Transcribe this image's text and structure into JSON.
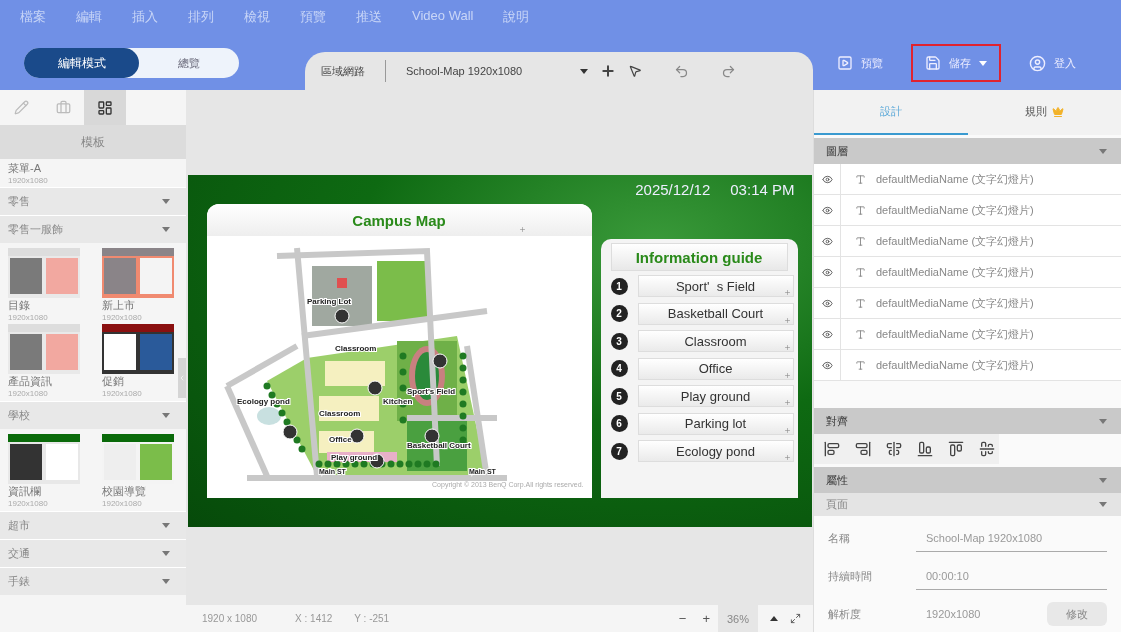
{
  "menu": [
    "檔案",
    "編輯",
    "插入",
    "排列",
    "檢視",
    "預覽",
    "推送",
    "Video Wall",
    "說明"
  ],
  "mode_toggle": [
    {
      "label": "編輯模式",
      "selected": true
    },
    {
      "label": "總覽",
      "selected": false
    }
  ],
  "toolbar": {
    "network": "區域網路",
    "project": "School-Map 1920x1080"
  },
  "actions": [
    {
      "label": "預覽",
      "kind": "preview",
      "highlighted": false
    },
    {
      "label": "儲存",
      "kind": "save",
      "highlighted": true
    },
    {
      "label": "登入",
      "kind": "login",
      "highlighted": false
    }
  ],
  "sidebar": {
    "tools": [
      {
        "kind": "pencil",
        "selected": false
      },
      {
        "kind": "briefcase",
        "selected": false
      },
      {
        "kind": "layout",
        "selected": true
      }
    ],
    "title": "模板",
    "top_item": {
      "name": "菜單-A",
      "size": "1920x1080"
    },
    "categories": [
      {
        "name": "零售"
      },
      {
        "name": "零售一服飾",
        "templates": [
          {
            "name": "目錄",
            "size": "1920x1080",
            "kind": "fashion"
          },
          {
            "name": "新上市",
            "size": "1920x1080",
            "kind": "arrival"
          },
          {
            "name": "產品資訊",
            "size": "1920x1080",
            "kind": "fashion"
          },
          {
            "name": "促銷",
            "size": "1920x1080",
            "kind": "promo"
          }
        ]
      },
      {
        "name": "學校",
        "templates": [
          {
            "name": "資訊欄",
            "size": "1920x1080",
            "kind": "news"
          },
          {
            "name": "校園導覽",
            "size": "1920x1080",
            "kind": "campus"
          }
        ]
      },
      {
        "name": "超市"
      },
      {
        "name": "交通"
      },
      {
        "name": "手錶"
      }
    ]
  },
  "slide": {
    "date": "2025/12/12",
    "time": "03:14 PM",
    "map": {
      "title": "Campus Map",
      "labels": [
        "Parking Lot",
        "Classroom",
        "Sport's Field",
        "Ecology pond",
        "Classroom",
        "Kitchen",
        "Office",
        "Play ground",
        "Basketball Court",
        "Main ST",
        "Main ST"
      ],
      "copyright": "Copyright © 2013 BenQ Corp.All rights reserved."
    },
    "guide": {
      "title": "Information guide",
      "items": [
        {
          "number": "1",
          "label": "Sport'  s Field"
        },
        {
          "number": "2",
          "label": "Basketball Court"
        },
        {
          "number": "3",
          "label": "Classroom"
        },
        {
          "number": "4",
          "label": "Office"
        },
        {
          "number": "5",
          "label": "Play ground"
        },
        {
          "number": "6",
          "label": "Parking lot"
        },
        {
          "number": "7",
          "label": "Ecology pond"
        }
      ]
    }
  },
  "status_bar": {
    "size": "1920 x 1080",
    "x": "X : 1412",
    "y": "Y : -251",
    "zoom_out": "−",
    "zoom_in": "+",
    "zoom": "36%"
  },
  "panel": {
    "tabs": [
      {
        "label": "設計",
        "selected": true,
        "premium": false
      },
      {
        "label": "規則",
        "selected": false,
        "premium": true
      }
    ],
    "layers": {
      "title": "圖層",
      "items": [
        {
          "name": "defaultMediaName (文字幻燈片)",
          "visible": true
        },
        {
          "name": "defaultMediaName (文字幻燈片)",
          "visible": true
        },
        {
          "name": "defaultMediaName (文字幻燈片)",
          "visible": true
        },
        {
          "name": "defaultMediaName (文字幻燈片)",
          "visible": true
        },
        {
          "name": "defaultMediaName (文字幻燈片)",
          "visible": true
        },
        {
          "name": "defaultMediaName (文字幻燈片)",
          "visible": true
        },
        {
          "name": "defaultMediaName (文字幻燈片)",
          "visible": true
        }
      ]
    },
    "align": {
      "title": "對齊"
    },
    "properties": {
      "title": "屬性",
      "subtitle": "頁面",
      "fields": [
        {
          "label": "名稱",
          "value": "School-Map 1920x1080",
          "kind": "input"
        },
        {
          "label": "持續時間",
          "value": "00:00:10",
          "kind": "input"
        },
        {
          "label": "解析度",
          "value": "1920x1080",
          "kind": "static",
          "button": "修改"
        }
      ]
    }
  }
}
